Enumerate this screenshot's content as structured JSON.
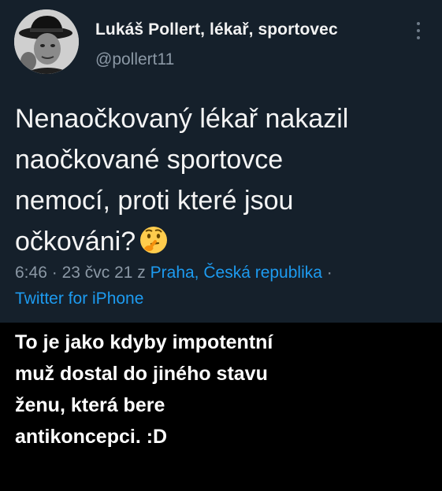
{
  "tweet": {
    "author_name": "Lukáš Pollert, lékař, sportovec",
    "handle": "@pollert11",
    "text_lines": [
      "Nenaočkovaný lékař nakazil",
      "naočkované sportovce",
      "nemocí, proti které jsou",
      "očkováni?"
    ],
    "emoji": "thinking-face",
    "time": "6:46",
    "separator": "·",
    "date": "23 čvc 21",
    "location_prefix": "z",
    "location": "Praha, Česká republika",
    "source": "Twitter for iPhone"
  },
  "caption": {
    "lines": [
      "To je jako kdyby impotentní",
      "muž dostal do jiného stavu",
      "ženu, která bere",
      "antikoncepci. :D"
    ]
  },
  "colors": {
    "background": "#15202b",
    "outer": "#000000",
    "link": "#1d9bf0",
    "secondary_text": "#8b98a5",
    "primary_text": "#f4f4f4"
  }
}
